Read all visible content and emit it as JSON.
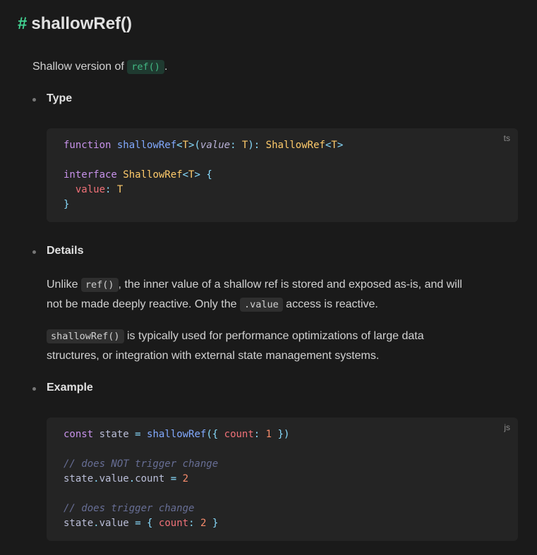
{
  "heading": {
    "anchor": "#",
    "title": "shallowRef()"
  },
  "intro": {
    "text_before": "Shallow version of ",
    "code": "ref()",
    "text_after": "."
  },
  "sections": {
    "type": {
      "label": "Type",
      "lang": "ts",
      "lines": [
        [
          "function",
          " ",
          "shallowRef",
          "<",
          "T",
          ">(",
          "value",
          ": ",
          "T",
          "): ",
          "ShallowRef",
          "<",
          "T",
          ">"
        ],
        [],
        [
          "interface",
          " ",
          "ShallowRef",
          "<",
          "T",
          "> {"
        ],
        [
          "  ",
          "value",
          ": ",
          "T"
        ],
        [
          "}"
        ]
      ]
    },
    "details": {
      "label": "Details",
      "para1": {
        "t1": "Unlike ",
        "c1": "ref()",
        "t2": ", the inner value of a shallow ref is stored and exposed as-is, and will",
        "t3": "not be made deeply reactive. Only the ",
        "c2": ".value",
        "t4": " access is reactive."
      },
      "para2": {
        "c1": "shallowRef()",
        "t1": " is typically used for performance optimizations of large data",
        "t2": "structures, or integration with external state management systems."
      }
    },
    "example": {
      "label": "Example",
      "lang": "js",
      "lines": [
        [
          "const",
          " state ",
          "=",
          " ",
          "shallowRef",
          "({ ",
          "count",
          ":",
          " ",
          "1",
          " })"
        ],
        [],
        [
          "// does NOT trigger change"
        ],
        [
          "state",
          ".",
          "value",
          ".",
          "count",
          " ",
          "=",
          " ",
          "2"
        ],
        [],
        [
          "// does trigger change"
        ],
        [
          "state",
          ".",
          "value",
          " ",
          "=",
          " { ",
          "count",
          ":",
          " ",
          "2",
          " }"
        ]
      ]
    }
  }
}
